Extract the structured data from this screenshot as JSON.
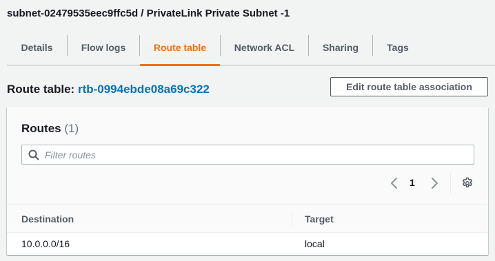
{
  "subnet_title": "subnet-02479535eec9ffc5d / PrivateLink Private Subnet -1",
  "tabs": [
    {
      "label": "Details",
      "active": false
    },
    {
      "label": "Flow logs",
      "active": false
    },
    {
      "label": "Route table",
      "active": true
    },
    {
      "label": "Network ACL",
      "active": false
    },
    {
      "label": "Sharing",
      "active": false
    },
    {
      "label": "Tags",
      "active": false
    }
  ],
  "route_table": {
    "label": "Route table: ",
    "id": "rtb-0994ebde08a69c322",
    "edit_button": "Edit route table association"
  },
  "routes": {
    "title": "Routes",
    "count": "(1)",
    "filter_placeholder": "Filter routes",
    "filter_value": "",
    "pagination": {
      "current_page": "1"
    },
    "columns": [
      "Destination",
      "Target"
    ],
    "rows": [
      {
        "destination": "10.0.0.0/16",
        "target": "local"
      }
    ]
  },
  "icons": {
    "search": "search-icon",
    "prev": "chevron-left-icon",
    "next": "chevron-right-icon",
    "settings": "gear-icon"
  },
  "colors": {
    "accent": "#ec7211",
    "link": "#0073bb",
    "background": "#f2f3f3"
  }
}
